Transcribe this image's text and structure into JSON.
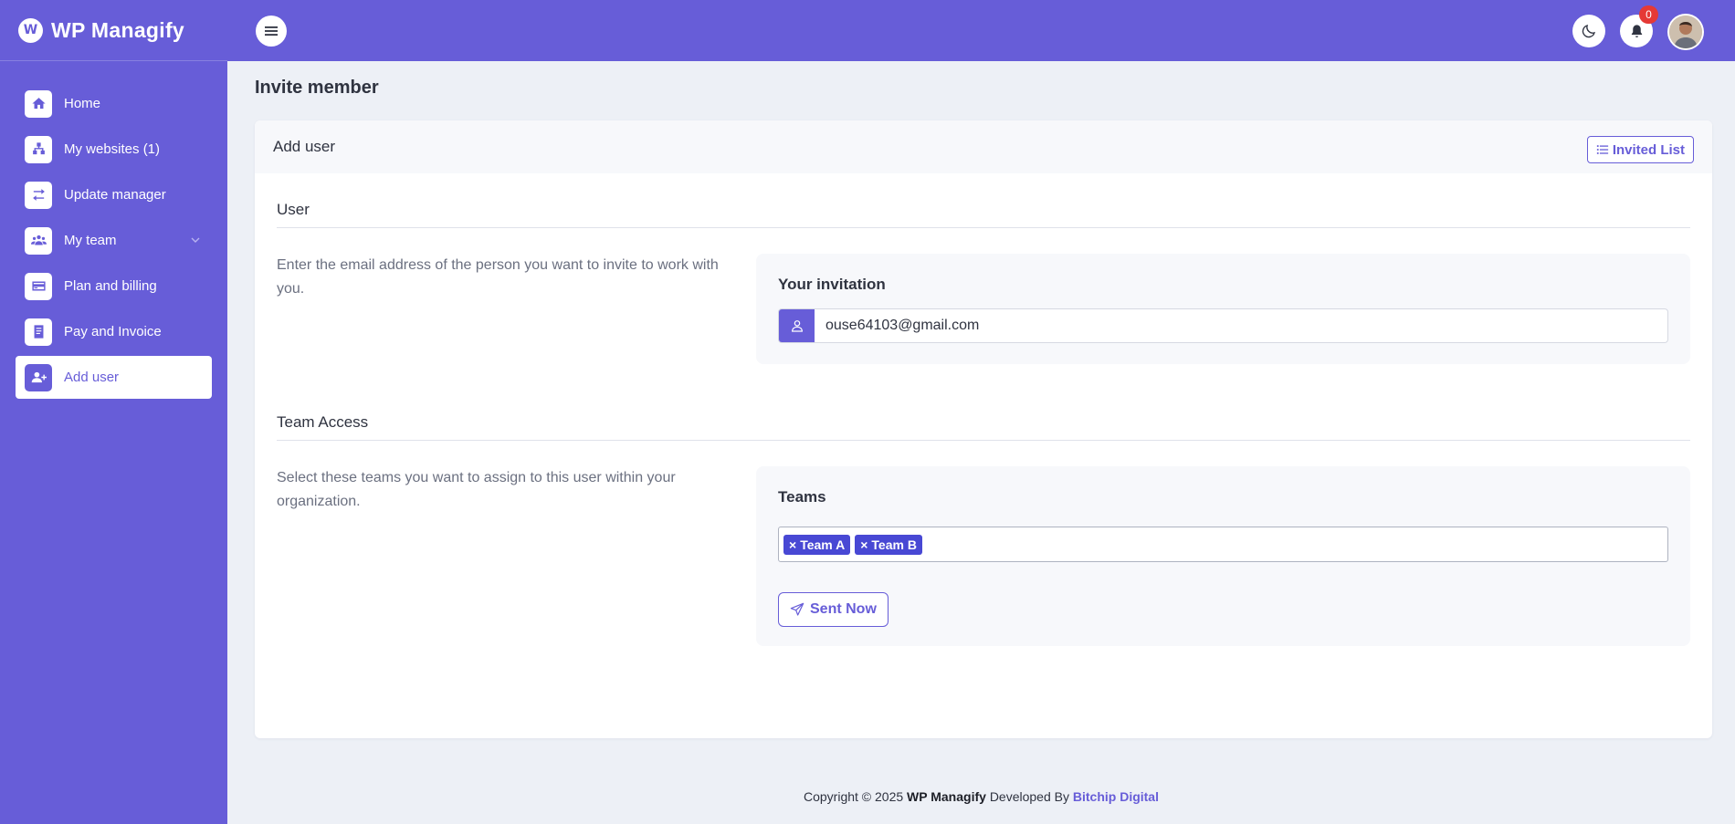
{
  "brand": {
    "name": "WP Managify",
    "logo_letter": "W"
  },
  "sidebar": {
    "items": [
      {
        "label": "Home",
        "icon": "home-icon"
      },
      {
        "label": "My websites (1)",
        "icon": "sitemap-icon"
      },
      {
        "label": "Update manager",
        "icon": "arrows-exchange-icon"
      },
      {
        "label": "My team",
        "icon": "users-icon",
        "has_submenu": true
      },
      {
        "label": "Plan and billing",
        "icon": "credit-card-icon"
      },
      {
        "label": "Pay and Invoice",
        "icon": "receipt-icon"
      },
      {
        "label": "Add user",
        "icon": "user-plus-icon",
        "active": true
      }
    ]
  },
  "topbar": {
    "notification_count": "0"
  },
  "page": {
    "title": "Invite member"
  },
  "card": {
    "title": "Add user",
    "invited_list_label": "Invited List",
    "user_section": {
      "title": "User",
      "description": "Enter the email address of the person you want to invite to work with you.",
      "panel_label": "Your invitation",
      "email_value": "ouse64103@gmail.com"
    },
    "team_section": {
      "title": "Team Access",
      "description": "Select these teams you want to assign to this user within your organization.",
      "panel_label": "Teams",
      "selected_teams": [
        "Team A",
        "Team B"
      ],
      "send_label": "Sent Now"
    }
  },
  "footer": {
    "prefix": "Copyright © 2025",
    "brand": "WP Managify",
    "middle": "Developed By",
    "developer": "Bitchip Digital"
  },
  "colors": {
    "primary": "#675dd8",
    "tag": "#4848d4",
    "badge": "#e53935",
    "background": "#edf0f6"
  }
}
